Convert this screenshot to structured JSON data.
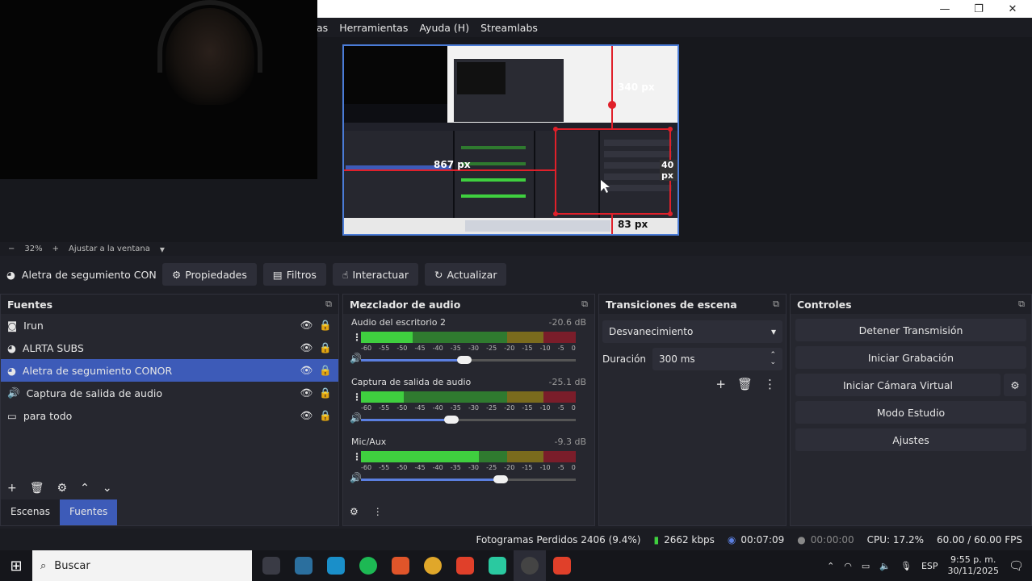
{
  "window": {
    "minimize": "—",
    "maximize": "❐",
    "close": "✕"
  },
  "menu": [
    "as",
    "Herramientas",
    "Ayuda (H)",
    "Streamlabs"
  ],
  "preview": {
    "annot_340": "340 px",
    "annot_867": "867 px",
    "annot_40": "40 px",
    "annot_83": "83 px"
  },
  "zoom": {
    "minus": "−",
    "value": "32%",
    "plus": "+",
    "fit": "Ajustar a la ventana",
    "caret": "▾"
  },
  "source_toolbar": {
    "selected_source": "Aletra de segumiento CONO",
    "properties": "Propiedades",
    "filters": "Filtros",
    "interact": "Interactuar",
    "refresh": "Actualizar"
  },
  "sources": {
    "title": "Fuentes",
    "items": [
      {
        "icon": "camera-icon",
        "label": "Irun",
        "selected": false
      },
      {
        "icon": "browser-icon",
        "label": "ALRTA SUBS",
        "selected": false
      },
      {
        "icon": "browser-icon",
        "label": "Aletra de segumiento CONOR",
        "selected": true
      },
      {
        "icon": "speaker-icon",
        "label": "Captura de salida de audio",
        "selected": false
      },
      {
        "icon": "monitor-icon",
        "label": "para todo",
        "selected": false
      }
    ],
    "tabs": [
      "Escenas",
      "Fuentes"
    ]
  },
  "mixer": {
    "title": "Mezclador de audio",
    "ticks": [
      "-60",
      "-55",
      "-50",
      "-45",
      "-40",
      "-35",
      "-30",
      "-25",
      "-20",
      "-15",
      "-10",
      "-5",
      "0"
    ],
    "channels": [
      {
        "name": "Audio del escritorio 2",
        "db": "-20.6 dB",
        "level": 0.24,
        "volume": 0.48
      },
      {
        "name": "Captura de salida de audio",
        "db": "-25.1 dB",
        "level": 0.2,
        "volume": 0.42
      },
      {
        "name": "Mic/Aux",
        "db": "-9.3 dB",
        "level": 0.55,
        "volume": 0.65
      }
    ]
  },
  "transitions": {
    "title": "Transiciones de escena",
    "selected": "Desvanecimiento",
    "duration_label": "Duración",
    "duration": "300 ms"
  },
  "controls": {
    "title": "Controles",
    "buttons": [
      "Detener Transmisión",
      "Iniciar Grabación",
      "Iniciar Cámara Virtual",
      "Modo Estudio",
      "Ajustes"
    ]
  },
  "status": {
    "dropped": "Fotogramas Perdidos 2406 (9.4%)",
    "bitrate": "2662 kbps",
    "stream_time": "00:07:09",
    "rec_time": "00:00:00",
    "cpu": "CPU: 17.2%",
    "fps": "60.00 / 60.00 FPS"
  },
  "taskbar": {
    "search": "Buscar",
    "lang": "ESP",
    "time": "9:55 p. m.",
    "date": "30/11/2025"
  },
  "colors": {
    "accent": "#3d5bb8",
    "annotation": "#e0202a",
    "meter_green": "#2f7a2f"
  }
}
